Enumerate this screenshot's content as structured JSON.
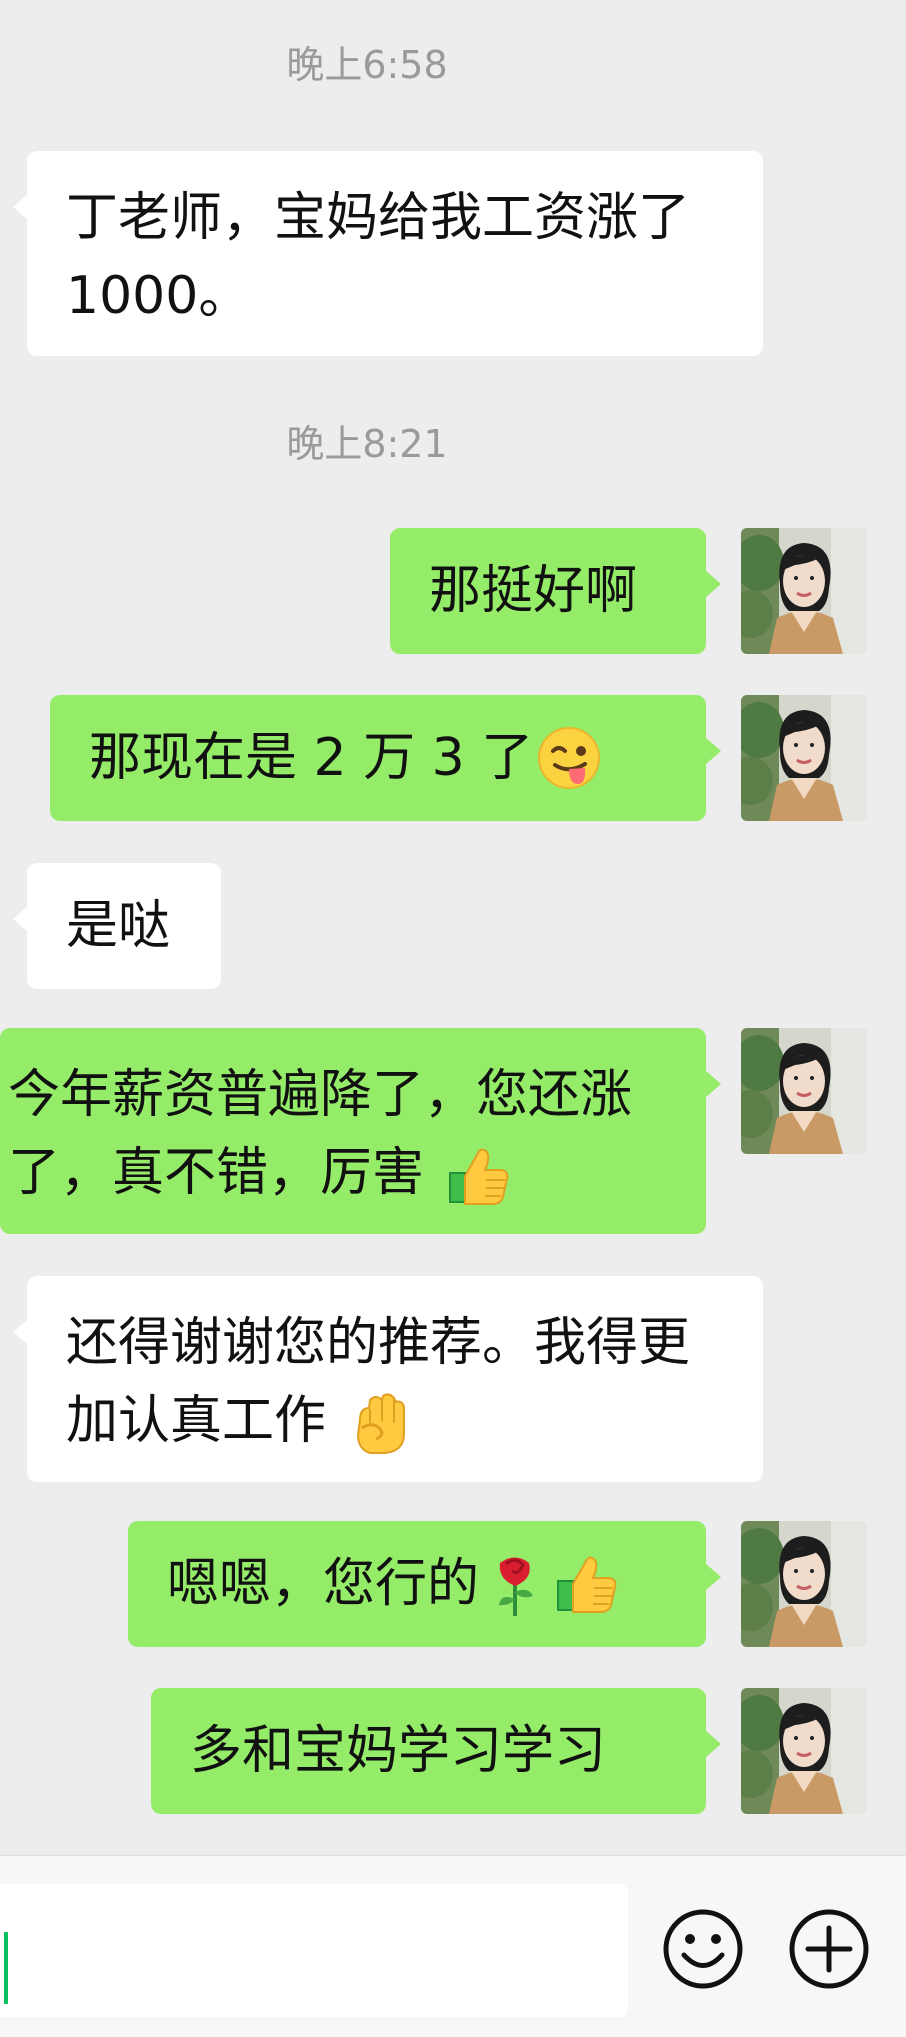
{
  "chat": {
    "timestamps": [
      "晚上6:58",
      "晚上8:21"
    ],
    "messages": [
      {
        "side": "left",
        "text": "丁老师，宝妈给我工资涨了 1000。"
      },
      {
        "side": "right",
        "text": "那挺好啊"
      },
      {
        "side": "right",
        "text": "那现在是 2 万 3 了",
        "emoji": "winking-tongue-emoji"
      },
      {
        "side": "left",
        "text": "是哒"
      },
      {
        "side": "right",
        "text": "今年薪资普遍降了，您还涨了，真不错，厉害",
        "emoji": "thumbs-up-emoji"
      },
      {
        "side": "left",
        "text": "还得谢谢您的推荐。我得更加认真工作",
        "emoji": "raised-fist-emoji"
      },
      {
        "side": "right",
        "text": "嗯嗯，您行的",
        "emojis": [
          "rose-emoji",
          "thumbs-up-emoji"
        ]
      },
      {
        "side": "right",
        "text": "多和宝妈学习学习"
      }
    ]
  },
  "input_bar": {
    "input_value": "",
    "icons": [
      "emoji-smile-icon",
      "plus-circle-icon"
    ]
  },
  "colors": {
    "background": "#ededed",
    "left_bubble": "#ffffff",
    "right_bubble": "#95ec69",
    "timestamp": "#9a9a9a",
    "cursor": "#07c160"
  }
}
